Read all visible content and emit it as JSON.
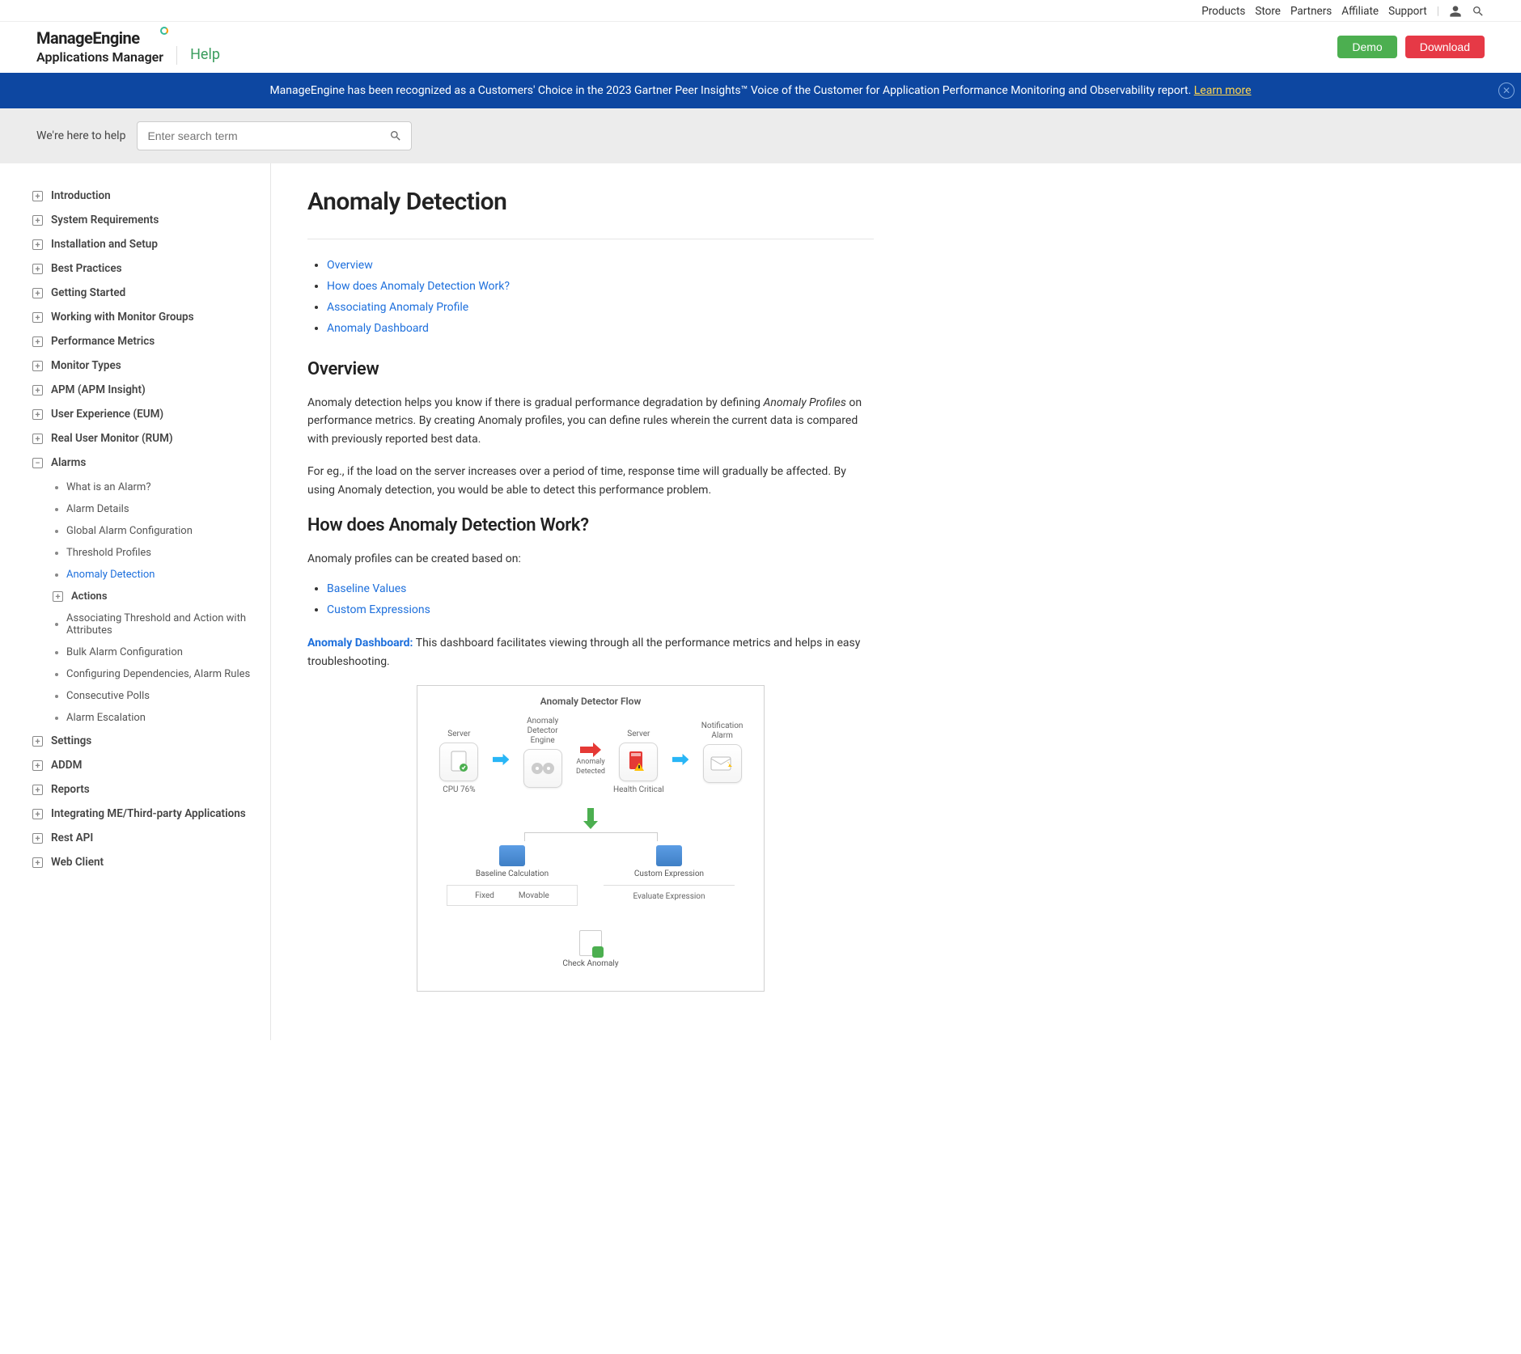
{
  "topNav": {
    "links": [
      "Products",
      "Store",
      "Partners",
      "Affiliate",
      "Support"
    ]
  },
  "header": {
    "logo": "ManageEngine",
    "product": "Applications Manager",
    "help": "Help",
    "demo": "Demo",
    "download": "Download"
  },
  "banner": {
    "text": "ManageEngine has been recognized as a Customers' Choice in the 2023 Gartner Peer Insights™ Voice of the Customer for Application Performance Monitoring and Observability report. ",
    "link": "Learn more"
  },
  "search": {
    "label": "We're here to help",
    "placeholder": "Enter search term"
  },
  "sidebar": {
    "closed": [
      "Introduction",
      "System Requirements",
      "Installation and Setup",
      "Best Practices",
      "Getting Started",
      "Working with Monitor Groups",
      "Performance Metrics",
      "Monitor Types",
      "APM (APM Insight)",
      "User Experience (EUM)",
      "Real User Monitor (RUM)"
    ],
    "open": {
      "label": "Alarms",
      "children": [
        "What is an Alarm?",
        "Alarm Details",
        "Global Alarm Configuration",
        "Threshold Profiles",
        "Anomaly Detection",
        "Actions",
        "Associating Threshold and Action with Attributes",
        "Bulk Alarm Configuration",
        "Configuring Dependencies, Alarm Rules",
        "Consecutive Polls",
        "Alarm Escalation"
      ]
    },
    "closed2": [
      "Settings",
      "ADDM",
      "Reports",
      "Integrating ME/Third-party Applications",
      "Rest API",
      "Web Client"
    ]
  },
  "content": {
    "h1": "Anomaly Detection",
    "toc": [
      "Overview",
      "How does Anomaly Detection Work?",
      "Associating Anomaly Profile",
      "Anomaly Dashboard"
    ],
    "overview": {
      "heading": "Overview",
      "p1a": "Anomaly detection helps you know if there is gradual performance degradation by defining ",
      "p1em": "Anomaly Profiles",
      "p1b": " on performance metrics. By creating Anomaly profiles, you can define rules wherein the current data is compared with previously reported best data.",
      "p2": "For eg., if the load on the server increases over a period of time, response time will gradually be affected. By using Anomaly detection, you would be able to detect this performance problem."
    },
    "how": {
      "heading": "How does Anomaly Detection Work?",
      "p1": "Anomaly profiles can be created based on:",
      "bullets": [
        "Baseline Values",
        "Custom Expressions"
      ],
      "p2link": "Anomaly Dashboard:",
      "p2rest": " This dashboard facilitates viewing through all the performance metrics and helps in easy troubleshooting."
    },
    "diagram": {
      "title": "Anomaly Detector Flow",
      "n1top": "Server",
      "n1bot": "CPU 76%",
      "n2top": "Anomaly Detector Engine",
      "n2bot": "",
      "arr2top": "Anomaly",
      "arr2bot": "Detected",
      "n3top": "Server",
      "n3bot": "Health Critical",
      "n4top": "Notification Alarm",
      "n4bot": "",
      "b1": "Baseline Calculation",
      "b1a": "Fixed",
      "b1b": "Movable",
      "b2": "Custom Expression",
      "b2a": "Evaluate Expression",
      "check": "Check Anomaly"
    }
  }
}
